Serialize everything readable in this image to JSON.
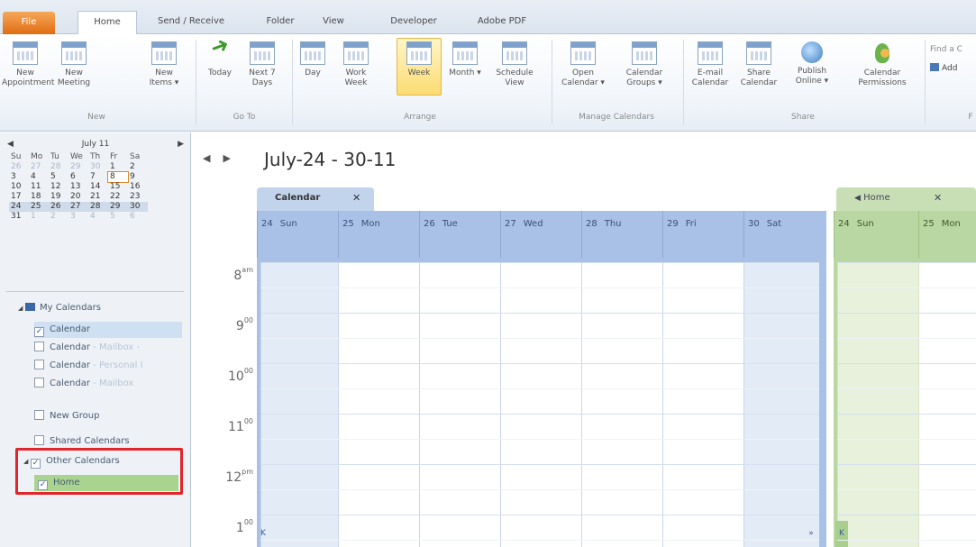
{
  "tabs": [
    "File",
    "Home",
    "Send / Receive",
    "Folder",
    "View",
    "Developer",
    "Adobe PDF"
  ],
  "ribbon": {
    "new_appointment": "New Appointment",
    "new_meeting": "New Meeting",
    "new_items": "New Items ▾",
    "group_new": "New",
    "today": "Today",
    "next7": "Next 7 Days",
    "group_goto": "Go To",
    "day": "Day",
    "work_week": "Work Week",
    "week": "Week",
    "month": "Month ▾",
    "schedule_view": "Schedule View",
    "group_arrange": "Arrange",
    "open_calendar": "Open Calendar ▾",
    "calendar_groups": "Calendar Groups ▾",
    "group_manage": "Manage Calendars",
    "email_calendar": "E-mail Calendar",
    "share_calendar": "Share Calendar",
    "publish_online": "Publish Online ▾",
    "calendar_permissions": "Calendar Permissions",
    "group_share": "Share",
    "find_contact": "Find a C",
    "address_book": "Add",
    "group_find": "F"
  },
  "mini_calendar": {
    "title": "July 11",
    "day_headers": [
      "Su",
      "Mo",
      "Tu",
      "We",
      "Th",
      "Fr",
      "Sa"
    ],
    "weeks": [
      [
        "26",
        "27",
        "28",
        "29",
        "30",
        "1",
        "2"
      ],
      [
        "3",
        "4",
        "5",
        "6",
        "7",
        "8",
        "9"
      ],
      [
        "10",
        "11",
        "12",
        "13",
        "14",
        "15",
        "16"
      ],
      [
        "17",
        "18",
        "19",
        "20",
        "21",
        "22",
        "23"
      ],
      [
        "24",
        "25",
        "26",
        "27",
        "28",
        "29",
        "30"
      ],
      [
        "31",
        "1",
        "2",
        "3",
        "4",
        "5",
        "6"
      ]
    ],
    "today": "8"
  },
  "nav": {
    "my_calendars": "My Calendars",
    "calendar": "Calendar",
    "calendar_mailbox1": "Calendar",
    "mailbox1_suffix": "- Mailbox -",
    "calendar_personal": "Calendar",
    "personal_suffix": "- Personal I",
    "calendar_mailbox2": "Calendar",
    "mailbox2_suffix": "- Mailbox",
    "new_group": "New Group",
    "shared_calendars": "Shared Calendars",
    "other_calendars": "Other Calendars",
    "home": "Home"
  },
  "view": {
    "week_title": "July-24 - 30-11",
    "calendar_tab": "Calendar",
    "home_tab": "Home",
    "days": [
      {
        "num": "24",
        "name": "Sun"
      },
      {
        "num": "25",
        "name": "Mon"
      },
      {
        "num": "26",
        "name": "Tue"
      },
      {
        "num": "27",
        "name": "Wed"
      },
      {
        "num": "28",
        "name": "Thu"
      },
      {
        "num": "29",
        "name": "Fri"
      },
      {
        "num": "30",
        "name": "Sat"
      }
    ],
    "home_days": [
      {
        "num": "24",
        "name": "Sun"
      },
      {
        "num": "25",
        "name": "Mon"
      }
    ],
    "times": [
      {
        "h": "8",
        "s": "am"
      },
      {
        "h": "9",
        "s": "00"
      },
      {
        "h": "10",
        "s": "00"
      },
      {
        "h": "11",
        "s": "00"
      },
      {
        "h": "12",
        "s": "pm"
      },
      {
        "h": "1",
        "s": "00"
      }
    ]
  },
  "colors": {
    "calendar_blue": "#a9c1e6",
    "home_green": "#b9d7a2",
    "highlight_red": "#e0262b",
    "file_tab_orange": "#e06c12"
  }
}
